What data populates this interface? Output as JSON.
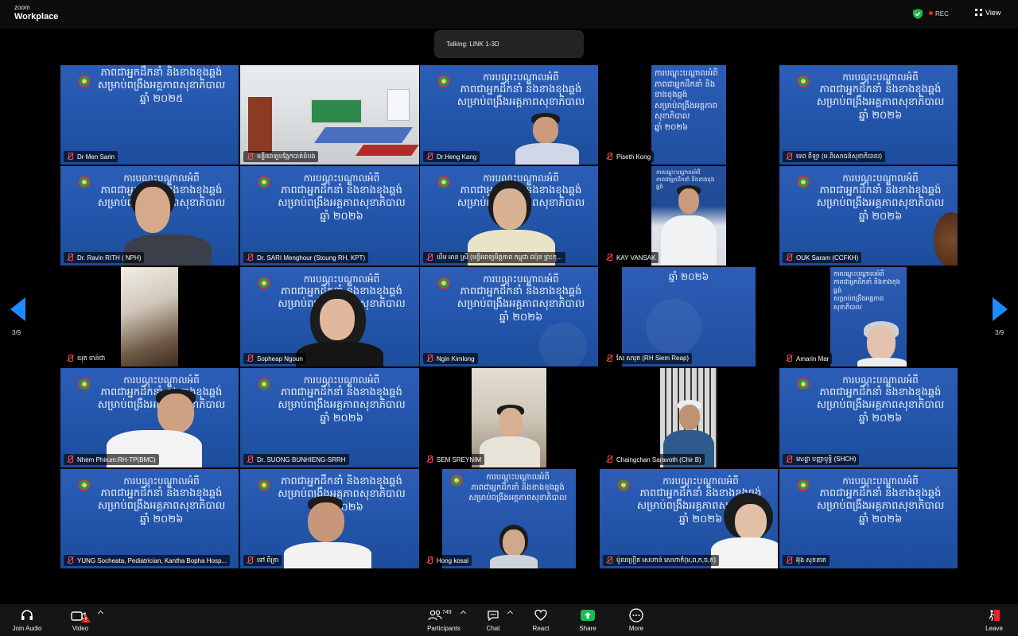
{
  "app": {
    "brand_small": "zoom",
    "brand_name": "Workplace"
  },
  "topbar": {
    "rec_label": "REC",
    "view_label": "View"
  },
  "talking": "Talking: LINK 1-3D",
  "pager": {
    "left_page": "3/9",
    "right_page": "3/9"
  },
  "slide_text": {
    "line1": "ការបណ្ដុះបណ្ដាលអំពី",
    "line2": "ភាពជាអ្នកដឹកនាំ និងខាងខុងឆ្ពង់",
    "line3": "សម្រាប់ពង្រឹងអគ្គភាពសុខាភិបាល",
    "line4": "ឆ្នាំ ២០២៦",
    "line4_alt": "ឆ្នាំ ២០២៥"
  },
  "participants": [
    {
      "name": "Dr Men Sarin"
    },
    {
      "name": "មន្ទីរពេទ្យបង្អែកបាត់ដំបង"
    },
    {
      "name": "Dr.Heng Kang"
    },
    {
      "name": "Piseth Kong"
    },
    {
      "name": "ទេព ពីឡា (ម.ពិសោធន៍សុខាភិបាល)"
    },
    {
      "name": "Dr. Ravin RITH ( NPH)"
    },
    {
      "name": "Dr. SARI Menghour (Stoung RH, KPT)"
    },
    {
      "name": "ឃឹម អាន ស្រី (មន្ទីរពេទ្យមិត្តភាព កម្ពុជា ជប៉ុន ព្រះកុ..."
    },
    {
      "name": "KAY VANSAK"
    },
    {
      "name": "OUK Saram (CCFKH)"
    },
    {
      "name": "យុត ចាន់ថា"
    },
    {
      "name": "Sopheap Ngoun"
    },
    {
      "name": "Ngin Kimlong"
    },
    {
      "name": "សែ សារុត (RH Siem Reap)"
    },
    {
      "name": "Amarin Mar"
    },
    {
      "name": "Nhem Phirum:RH-TP(BMC)"
    },
    {
      "name": "Dr. SUONG BUNHIENG-SRRH"
    },
    {
      "name": "SEM SREYNIM"
    },
    {
      "name": "Chaingchan Saravoth (Chir B)"
    },
    {
      "name": "សេដ្ឋា បញ្ញាឫទ្ធិ (SHCH)"
    },
    {
      "name": "YUNG Socheata, Pediatrician, Kantha Bopha Hosp..."
    },
    {
      "name": "ទៅ ពិត្រា"
    },
    {
      "name": "Hong kosal"
    },
    {
      "name": "ម៉ូលប្រឿត សេហាន់ សេហាក៏(ម,ព,ក,ច,ក)"
    },
    {
      "name": "អ៊ុង សុខនាត"
    }
  ],
  "toolbar": {
    "join_audio": "Join Audio",
    "video": "Video",
    "participants": "Participants",
    "participants_count": "749",
    "chat": "Chat",
    "react": "React",
    "share": "Share",
    "more": "More",
    "leave": "Leave"
  },
  "colors": {
    "accent": "#1a8cff",
    "slide_blue": "#2255aa",
    "share_green": "#1db954",
    "mute_red": "#ff4a4a"
  }
}
